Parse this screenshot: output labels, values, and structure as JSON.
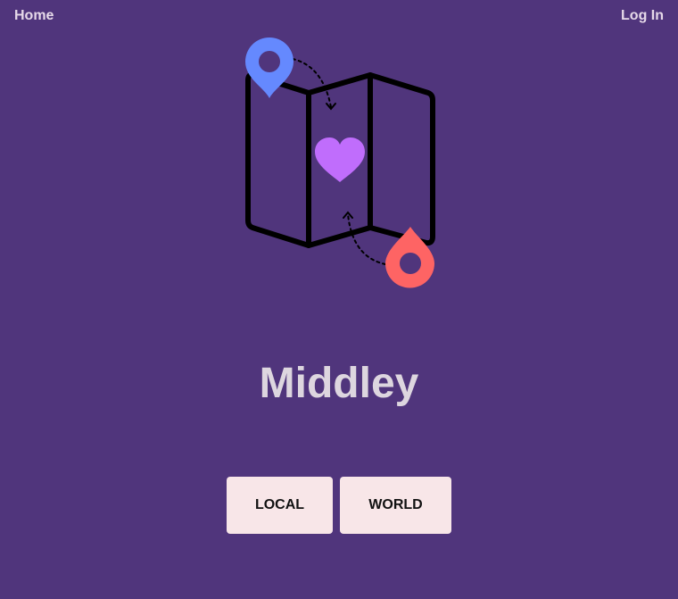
{
  "nav": {
    "home_label": "Home",
    "login_label": "Log In"
  },
  "hero": {
    "title": "Middley",
    "icons": [
      "folded-map-icon",
      "location-pin-icon",
      "heart-icon",
      "drop-pin-icon"
    ],
    "colors": {
      "map_outline": "#000000",
      "blue_pin": "#6589fe",
      "heart": "#c06dfc",
      "red_pin": "#fe6464"
    }
  },
  "actions": {
    "local_label": "LOCAL",
    "world_label": "WORLD"
  },
  "theme": {
    "background": "#50357c",
    "text_light": "#ddd6df",
    "button_bg": "#f8e6e8"
  }
}
